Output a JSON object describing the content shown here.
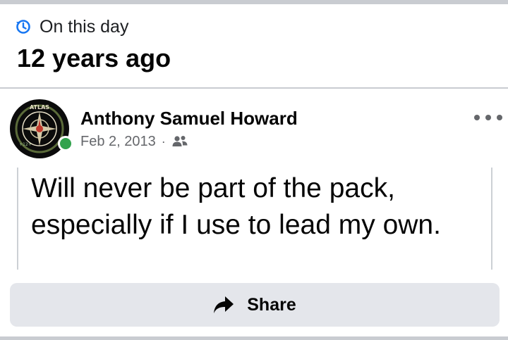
{
  "memory": {
    "section_label": "On this day",
    "years_ago": "12 years ago",
    "icon": "clock-rewind-icon"
  },
  "post": {
    "author": "Anthony Samuel Howard",
    "date": "Feb 2, 2013",
    "separator": "·",
    "audience_icon": "friends-icon",
    "more_icon": "more-options-icon",
    "avatar_text": "ATLAS",
    "avatar_badge": "+12+",
    "online": true,
    "text_line_1": "Will never be part of the pack,",
    "text_line_2": "especially if I use to lead my own."
  },
  "actions": {
    "share_label": "Share",
    "share_icon": "share-arrow-icon"
  },
  "colors": {
    "accent": "#1877f2",
    "online": "#31a24c",
    "muted_text": "#65676b",
    "button_bg": "#e4e6eb",
    "divider": "#c9ccd1"
  }
}
